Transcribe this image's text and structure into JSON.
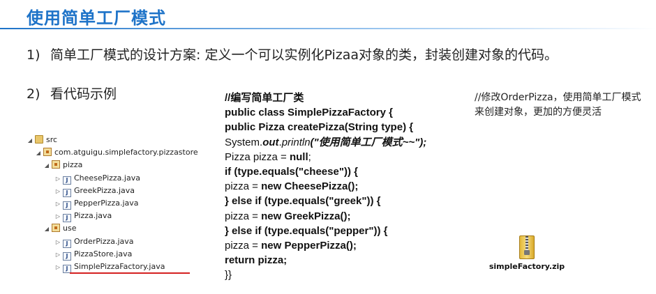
{
  "title": "使用简单工厂模式",
  "points": [
    {
      "num": "1)",
      "text": "简单工厂模式的设计方案: 定义一个可以实例化Pizaa对象的类，封装创建对象的代码。"
    },
    {
      "num": "2)",
      "text": "看代码示例"
    }
  ],
  "tree": {
    "src": "src",
    "package": "com.atguigu.simplefactory.pizzastore",
    "pizza_pkg": "pizza",
    "pizza_files": [
      "CheesePizza.java",
      "GreekPizza.java",
      "PepperPizza.java",
      "Pizza.java"
    ],
    "use_pkg": "use",
    "use_files": [
      "OrderPizza.java",
      "PizzaStore.java",
      "SimplePizzaFactory.java"
    ],
    "java_icon_glyph": "J",
    "expanded_arrow": "◢",
    "collapsed_arrow": "▷"
  },
  "code": {
    "comment": "//编写简单工厂类",
    "class_decl": "public class SimplePizzaFactory {",
    "method_decl": "public Pizza createPizza(String type) {",
    "println_prefix": "System.",
    "println_out": "out",
    "println_dot": ".",
    "println_method": "println",
    "println_arg": "(\"使用简单工厂模式~~\");",
    "decl_prefix": "Pizza pizza = ",
    "decl_null": "null",
    "decl_suffix": ";",
    "if_cheese": "if (type.equals(\"cheese\")) {",
    "assign_prefix": "pizza = ",
    "new_cheese": "new CheesePizza();",
    "elseif_greek": "} else if (type.equals(\"greek\")) {",
    "new_greek": "new GreekPizza();",
    "elseif_pepper": "} else if (type.equals(\"pepper\")) {",
    "new_pepper": "new PepperPizza();",
    "return_stmt": "return pizza;",
    "close": "}}"
  },
  "note": "//修改OrderPizza，使用简单工厂模式来创建对象，更加的方便灵活",
  "zip_file": "simpleFactory.zip",
  "colors": {
    "title": "#1e73c8",
    "underline": "#d42020"
  }
}
